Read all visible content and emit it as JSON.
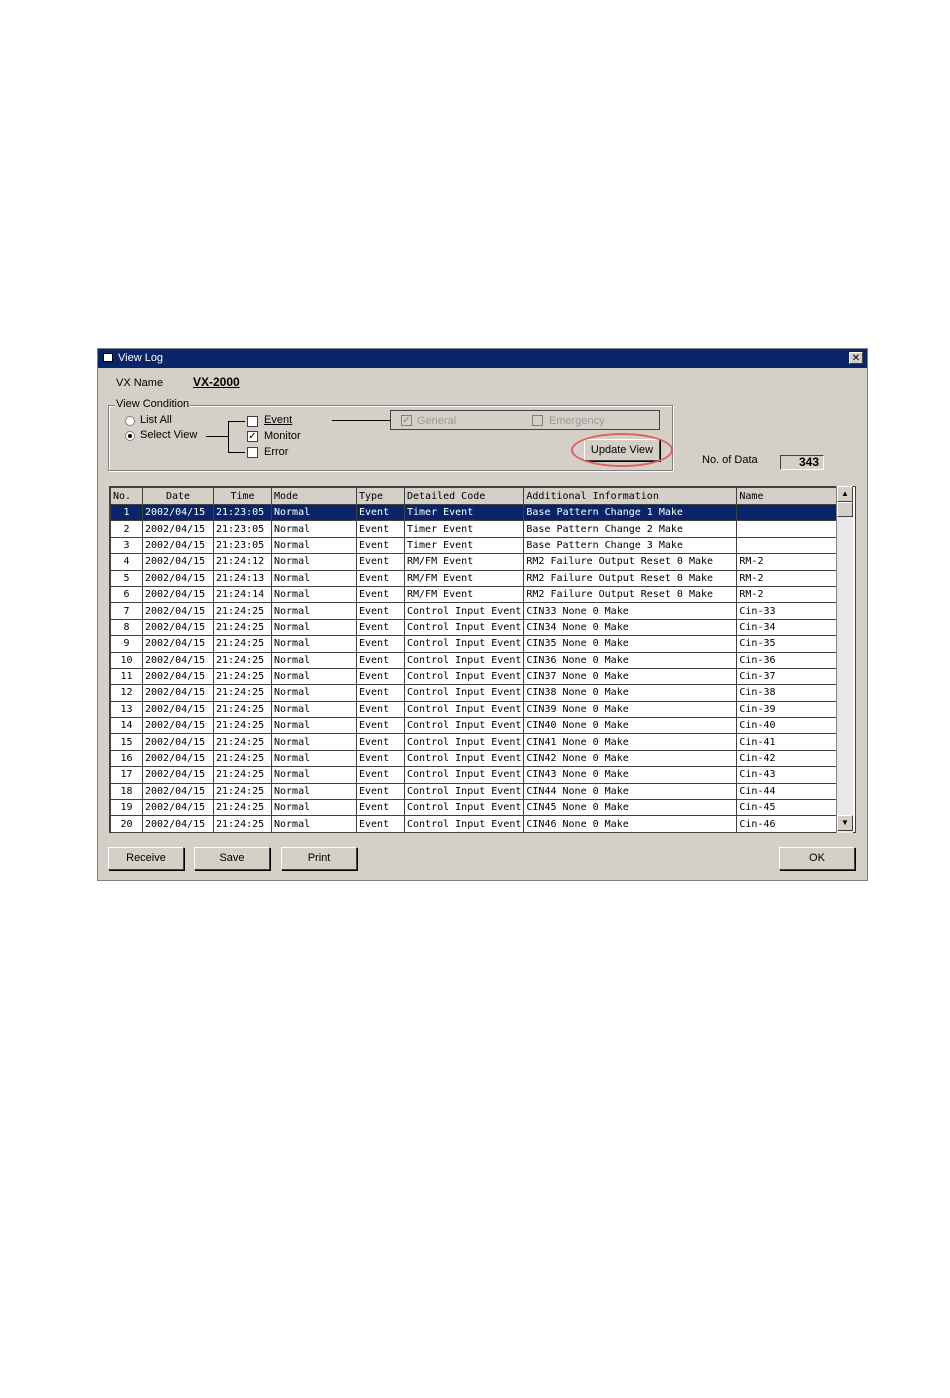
{
  "window": {
    "title": "View Log",
    "close_glyph": "✕"
  },
  "vx_name": {
    "label": "VX Name",
    "value": "VX-2000"
  },
  "view_condition": {
    "legend": "View Condition",
    "list_all": "List All",
    "select_view": "Select View",
    "selected": "Select View",
    "checks": [
      {
        "label": "Event",
        "checked": false
      },
      {
        "label": "Monitor",
        "checked": true
      },
      {
        "label": "Error",
        "checked": false
      }
    ],
    "general": {
      "label": "General",
      "checked": true,
      "enabled": false
    },
    "emergency": {
      "label": "Emergency",
      "checked": false,
      "enabled": false
    },
    "update_button": "Update View"
  },
  "no_of_data": {
    "label": "No. of Data",
    "value": "343"
  },
  "table": {
    "columns": [
      "No.",
      "Date",
      "Time",
      "Mode",
      "Type",
      "Detailed Code",
      "Additional Information",
      "Name"
    ],
    "selected_row": 0,
    "rows": [
      [
        "1",
        "2002/04/15",
        "21:23:05",
        "Normal",
        "Event",
        "Timer Event",
        "Base Pattern Change 1 Make",
        ""
      ],
      [
        "2",
        "2002/04/15",
        "21:23:05",
        "Normal",
        "Event",
        "Timer Event",
        "Base Pattern Change 2 Make",
        ""
      ],
      [
        "3",
        "2002/04/15",
        "21:23:05",
        "Normal",
        "Event",
        "Timer Event",
        "Base Pattern Change 3 Make",
        ""
      ],
      [
        "4",
        "2002/04/15",
        "21:24:12",
        "Normal",
        "Event",
        "RM/FM Event",
        "RM2 Failure Output Reset 0 Make",
        "RM-2"
      ],
      [
        "5",
        "2002/04/15",
        "21:24:13",
        "Normal",
        "Event",
        "RM/FM Event",
        "RM2 Failure Output Reset 0 Make",
        "RM-2"
      ],
      [
        "6",
        "2002/04/15",
        "21:24:14",
        "Normal",
        "Event",
        "RM/FM Event",
        "RM2 Failure Output Reset 0 Make",
        "RM-2"
      ],
      [
        "7",
        "2002/04/15",
        "21:24:25",
        "Normal",
        "Event",
        "Control Input Event",
        "CIN33 None 0 Make",
        "Cin-33"
      ],
      [
        "8",
        "2002/04/15",
        "21:24:25",
        "Normal",
        "Event",
        "Control Input Event",
        "CIN34 None 0 Make",
        "Cin-34"
      ],
      [
        "9",
        "2002/04/15",
        "21:24:25",
        "Normal",
        "Event",
        "Control Input Event",
        "CIN35 None 0 Make",
        "Cin-35"
      ],
      [
        "10",
        "2002/04/15",
        "21:24:25",
        "Normal",
        "Event",
        "Control Input Event",
        "CIN36 None 0 Make",
        "Cin-36"
      ],
      [
        "11",
        "2002/04/15",
        "21:24:25",
        "Normal",
        "Event",
        "Control Input Event",
        "CIN37 None 0 Make",
        "Cin-37"
      ],
      [
        "12",
        "2002/04/15",
        "21:24:25",
        "Normal",
        "Event",
        "Control Input Event",
        "CIN38 None 0 Make",
        "Cin-38"
      ],
      [
        "13",
        "2002/04/15",
        "21:24:25",
        "Normal",
        "Event",
        "Control Input Event",
        "CIN39 None 0 Make",
        "Cin-39"
      ],
      [
        "14",
        "2002/04/15",
        "21:24:25",
        "Normal",
        "Event",
        "Control Input Event",
        "CIN40 None 0 Make",
        "Cin-40"
      ],
      [
        "15",
        "2002/04/15",
        "21:24:25",
        "Normal",
        "Event",
        "Control Input Event",
        "CIN41 None 0 Make",
        "Cin-41"
      ],
      [
        "16",
        "2002/04/15",
        "21:24:25",
        "Normal",
        "Event",
        "Control Input Event",
        "CIN42 None 0 Make",
        "Cin-42"
      ],
      [
        "17",
        "2002/04/15",
        "21:24:25",
        "Normal",
        "Event",
        "Control Input Event",
        "CIN43 None 0 Make",
        "Cin-43"
      ],
      [
        "18",
        "2002/04/15",
        "21:24:25",
        "Normal",
        "Event",
        "Control Input Event",
        "CIN44 None 0 Make",
        "Cin-44"
      ],
      [
        "19",
        "2002/04/15",
        "21:24:25",
        "Normal",
        "Event",
        "Control Input Event",
        "CIN45 None 0 Make",
        "Cin-45"
      ],
      [
        "20",
        "2002/04/15",
        "21:24:25",
        "Normal",
        "Event",
        "Control Input Event",
        "CIN46 None 0 Make",
        "Cin-46"
      ]
    ]
  },
  "buttons": {
    "receive": "Receive",
    "save": "Save",
    "print": "Print",
    "ok": "OK"
  },
  "scrollbar": {
    "up": "▲",
    "down": "▼"
  },
  "colors": {
    "title_bar": "#0a246a",
    "selection": "#0a246a",
    "highlight_circle": "#e06060",
    "face": "#d4d0c8"
  }
}
